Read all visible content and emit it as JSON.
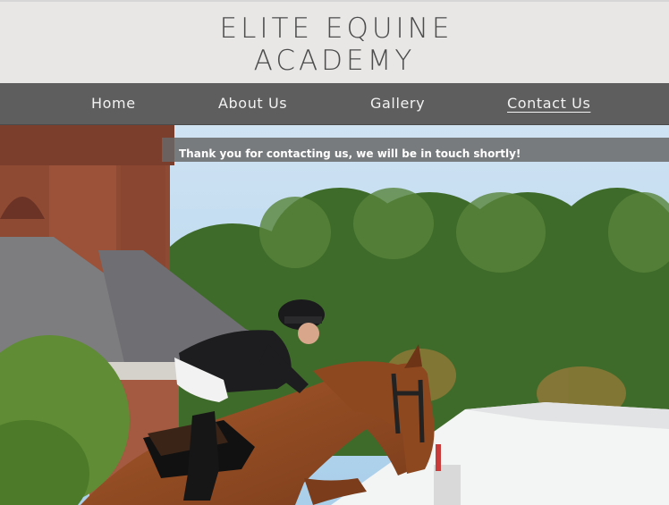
{
  "site": {
    "logo_line1": "ELITE EQUINE",
    "logo_line2": "ACADEMY"
  },
  "nav": {
    "items": [
      {
        "label": "Home",
        "active": false
      },
      {
        "label": "About Us",
        "active": false
      },
      {
        "label": "Gallery",
        "active": false
      },
      {
        "label": "Contact Us",
        "active": true
      }
    ]
  },
  "hero": {
    "confirmation_message": "Thank you for contacting us, we will be in touch shortly!"
  },
  "colors": {
    "header_bg": "#e8e7e6",
    "nav_bg": "#5e5e5e",
    "logo_text": "#4d4d4d",
    "banner_bg": "#696969"
  }
}
